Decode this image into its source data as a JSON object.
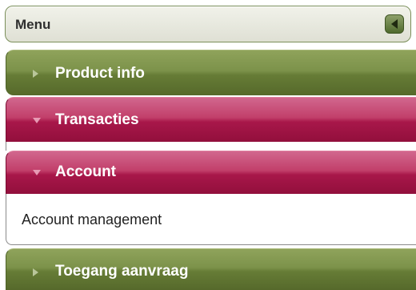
{
  "menu": {
    "title": "Menu",
    "collapse_icon": "triangle-left-icon"
  },
  "sections": [
    {
      "label": "Product info",
      "state": "collapsed",
      "color": "#6f843e"
    },
    {
      "label": "Transacties",
      "state": "expanded",
      "color": "#b21c50"
    },
    {
      "label": "Account",
      "state": "expanded",
      "color": "#b21c50",
      "items": [
        {
          "label": "Account management"
        }
      ]
    },
    {
      "label": "Toegang aanvraag",
      "state": "collapsed",
      "color": "#6f843e"
    }
  ]
}
